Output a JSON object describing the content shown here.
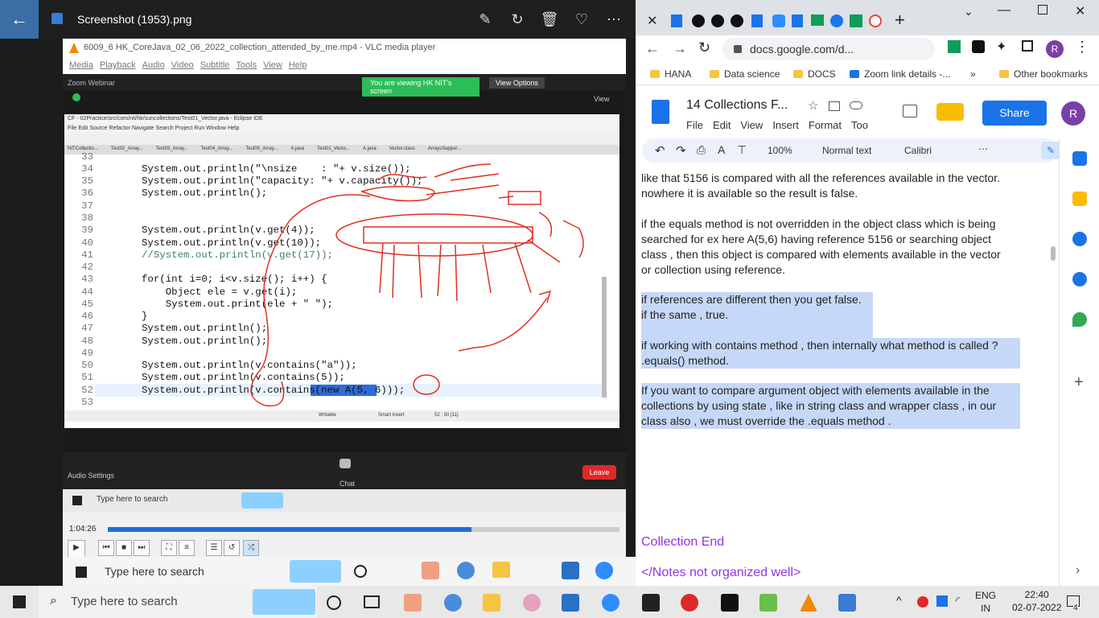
{
  "photos": {
    "title": "Screenshot (1953).png"
  },
  "vlc": {
    "title": "6009_6 HK_CoreJava_02_06_2022_collection_attended_by_me.mp4 - VLC media player",
    "menu": [
      "Media",
      "Playback",
      "Audio",
      "Video",
      "Subtitle",
      "Tools",
      "View",
      "Help"
    ],
    "time": "1:04:26",
    "progress": 0.71
  },
  "zoom": {
    "webinar_label": "Zoom Webinar",
    "banner": "You are viewing HK NIT's screen",
    "view_options": "View Options",
    "view": "View",
    "audio_settings": "Audio Settings",
    "chat": "Chat",
    "leave": "Leave"
  },
  "eclipse": {
    "title": "CF - 02Practice/src/com/nit/hk/suncollections/Test01_Vector.java - Eclipse IDE",
    "menu": [
      "File",
      "Edit",
      "Source",
      "Refactor",
      "Navigate",
      "Search",
      "Project",
      "Run",
      "Window",
      "Help"
    ],
    "tabs": [
      "NITCollectio...",
      "Test02_Array...",
      "Test03_Array...",
      "Test04_Array...",
      "Test05_Array...",
      "A.java",
      "Test01_Vecto...",
      "A.java",
      "Vector.class",
      "ArraysSuppor..."
    ],
    "status": {
      "writable": "Writable",
      "insert": "Smart Insert",
      "pos": "52 : 50 [11]"
    }
  },
  "code": [
    {
      "n": "33",
      "t": ""
    },
    {
      "n": "34",
      "t": "System.out.println(\"\\nsize    : \"+ v.size());"
    },
    {
      "n": "35",
      "t": "System.out.println(\"capacity: \"+ v.capacity());"
    },
    {
      "n": "36",
      "t": "System.out.println();"
    },
    {
      "n": "37",
      "t": ""
    },
    {
      "n": "38",
      "t": ""
    },
    {
      "n": "39",
      "t": "System.out.println(v.get(4));"
    },
    {
      "n": "40",
      "t": "System.out.println(v.get(10));"
    },
    {
      "n": "41",
      "t": "//System.out.println(v.get(17));"
    },
    {
      "n": "42",
      "t": ""
    },
    {
      "n": "43",
      "t": "for(int i=0; i<v.size(); i++) {"
    },
    {
      "n": "44",
      "t": "    Object ele = v.get(i);"
    },
    {
      "n": "45",
      "t": "    System.out.print(ele + \" \");"
    },
    {
      "n": "46",
      "t": "}"
    },
    {
      "n": "47",
      "t": "System.out.println();"
    },
    {
      "n": "48",
      "t": "System.out.println();"
    },
    {
      "n": "49",
      "t": ""
    },
    {
      "n": "50",
      "t": "System.out.println(v.contains(\"a\"));"
    },
    {
      "n": "51",
      "t": "System.out.println(v.contains(5));"
    },
    {
      "n": "52",
      "t": "System.out.println(v.contains(new A(5, 6)));"
    },
    {
      "n": "53",
      "t": ""
    }
  ],
  "inner_taskbar": {
    "search": "Type here to search"
  },
  "chrome": {
    "url": "docs.google.com/d...",
    "bookmarks": [
      "HANA",
      "Data science",
      "DOCS",
      "Zoom link details -...",
      "Other bookmarks"
    ],
    "avatar": "R"
  },
  "docs": {
    "title": "14 Collections F...",
    "menu": [
      "File",
      "Edit",
      "View",
      "Insert",
      "Format",
      "Too"
    ],
    "share": "Share",
    "zoom": "100%",
    "style": "Normal text",
    "font": "Calibri",
    "lines": [
      "like that 5156 is compared with all the references available in the vector.",
      "nowhere it is available so the result is false.",
      " if the equals method is not overridden in the object class which is being",
      "searched for ex here A(5,6) having reference 5156 or searching object",
      "class , then this object is compared with elements available in the vector",
      "or collection using reference.",
      "if references are different then you get false.",
      "if the same , true.",
      "if working with contains method , then internally what method is called ?",
      ".equals() method.",
      "If you want to compare argument object with elements available in the",
      "collections by using state , like in string class and wrapper class , in our",
      "class also , we must override the .equals method .",
      "Collection End",
      "</Notes not organized well>"
    ]
  },
  "taskbar": {
    "search": "Type here to search",
    "lang1": "ENG",
    "lang2": "IN",
    "time": "22:40",
    "date": "02-07-2022",
    "notif": "4"
  },
  "colors": {
    "accent": "#1a73e8",
    "purple": "#9334e6",
    "annotation": "#e0301e"
  }
}
